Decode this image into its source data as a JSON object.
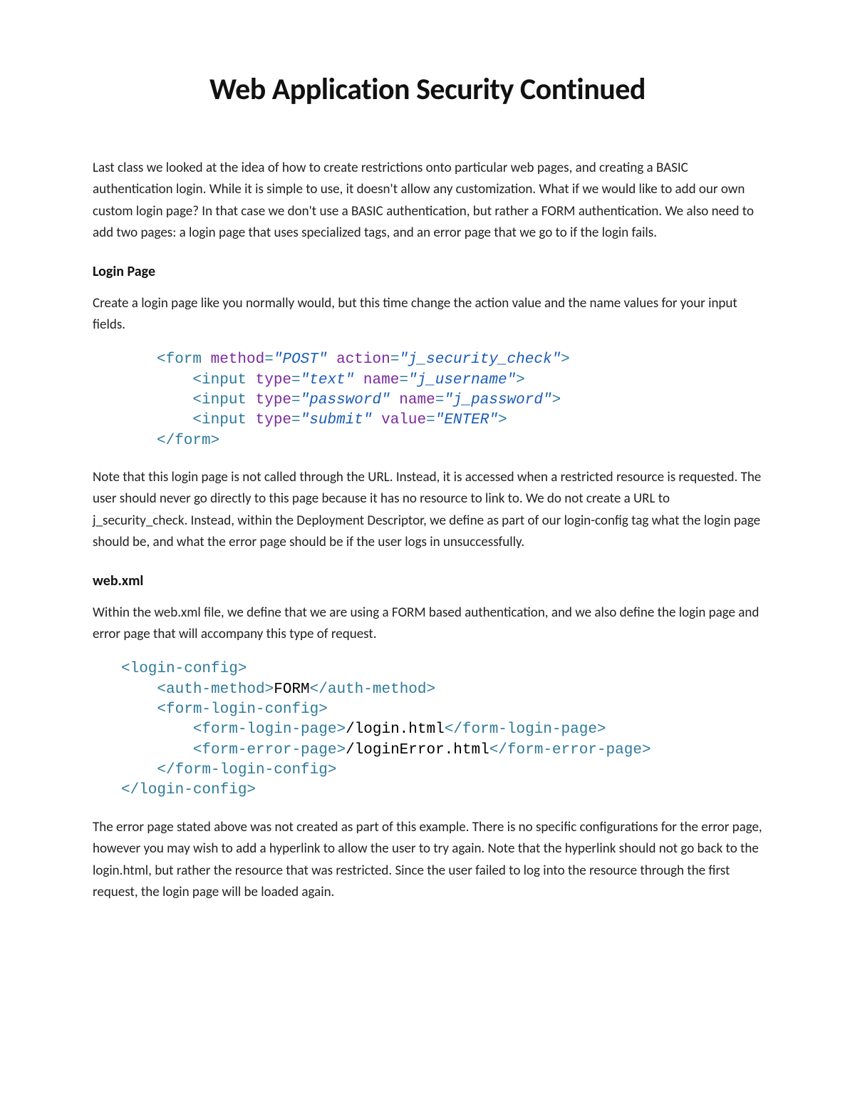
{
  "title": "Web Application Security Continued",
  "intro": "Last class we looked at the idea of how to create restrictions onto particular web pages, and creating a BASIC authentication login.  While it is simple to use, it doesn't allow any customization.  What if we would like to add our own custom login page?  In that case we don't use a BASIC authentication, but rather a FORM authentication.  We also need to add two pages: a login page that uses specialized tags, and an error page that we go to if the login fails.",
  "section1": {
    "heading": "Login Page",
    "para1": "Create a login page like you normally would, but this time change the action value and the name values for your input fields.",
    "code": {
      "l1_open": "<form ",
      "l1_a1": "method",
      "l1_eq": "=",
      "l1_v1": "\"POST\"",
      "l1_sp": " ",
      "l1_a2": "action",
      "l1_v2": "\"j_security_check\"",
      "l1_close": ">",
      "l2_open": "    <input ",
      "l2_a1": "type",
      "l2_v1": "\"text\"",
      "l2_sp": " ",
      "l2_a2": "name",
      "l2_v2": "\"j_username\"",
      "l2_close": ">",
      "l3_open": "    <input ",
      "l3_a1": "type",
      "l3_v1": "\"password\"",
      "l3_sp": " ",
      "l3_a2": "name",
      "l3_v2": "\"j_password\"",
      "l3_close": ">",
      "l4_open": "    <input ",
      "l4_a1": "type",
      "l4_v1": "\"submit\"",
      "l4_sp": " ",
      "l4_a2": "value",
      "l4_v2": "\"ENTER\"",
      "l4_close": ">",
      "l5": "</form>"
    },
    "para2": "Note that this login page is not called through the URL.  Instead, it is accessed when a restricted resource is requested.  The user should never go directly to this page because it has no resource to link to.  We do not create a URL to j_security_check.  Instead, within the Deployment Descriptor, we define as part of our login-config tag what the login page should be, and what the error page should be if the user logs in unsuccessfully."
  },
  "section2": {
    "heading": "web.xml",
    "para1": "Within the web.xml file, we define that we are using a FORM based authentication, and we also define the login page and error page that will accompany this type of request.",
    "code": {
      "l1": "<login-config>",
      "l2a": "    <auth-method>",
      "l2b": "FORM",
      "l2c": "</auth-method>",
      "l3": "    <form-login-config>",
      "l4a": "        <form-login-page>",
      "l4b": "/login.html",
      "l4c": "</form-login-page>",
      "l5a": "        <form-error-page>",
      "l5b": "/loginError.html",
      "l5c": "</form-error-page>",
      "l6": "    </form-login-config>",
      "l7": "</login-config>"
    },
    "para2": "The error page stated above was not created as part of this example.  There is no specific configurations for the error page, however you may wish to add a hyperlink to allow the user to try again.  Note that the hyperlink should not go back to the login.html, but rather the resource that was restricted.  Since the user failed to log into the resource through the first request, the login page will be loaded again."
  }
}
